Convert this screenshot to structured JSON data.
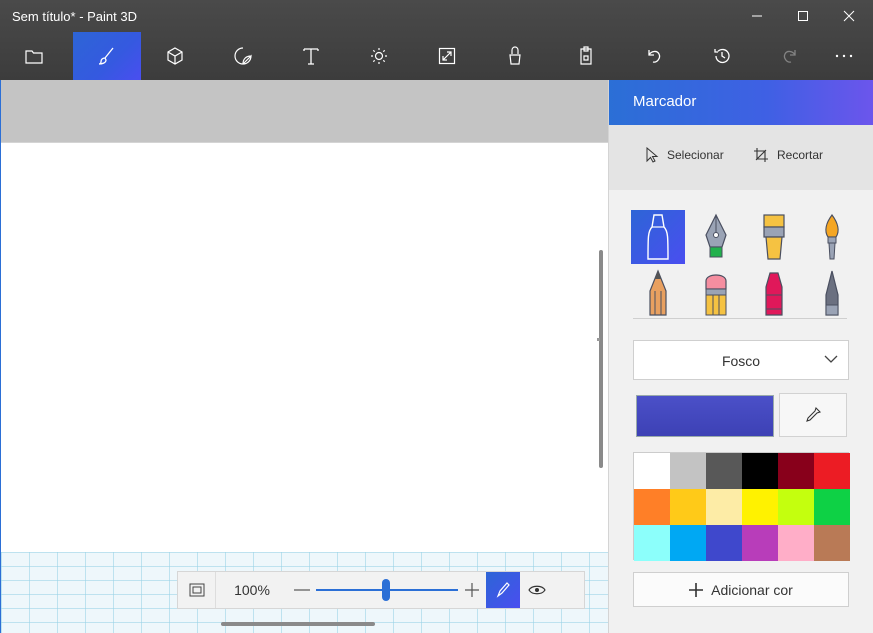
{
  "window": {
    "title": "Sem título* - Paint 3D"
  },
  "toolbar": {
    "items": [
      {
        "icon": "folder-icon"
      },
      {
        "icon": "brush-icon",
        "active": true
      },
      {
        "icon": "cube-icon"
      },
      {
        "icon": "sticker-icon"
      },
      {
        "icon": "text-icon",
        "glyph": "T"
      },
      {
        "icon": "effects-sun-icon"
      },
      {
        "icon": "canvas-resize-icon"
      },
      {
        "icon": "mixed-reality-icon"
      },
      {
        "icon": "paste-icon"
      },
      {
        "icon": "undo-icon"
      },
      {
        "icon": "history-icon"
      },
      {
        "icon": "redo-icon",
        "disabled": true
      },
      {
        "icon": "more-icon",
        "glyph": "···"
      }
    ]
  },
  "zoom": {
    "value": "100%",
    "minus": "—",
    "plus": "+",
    "slider_level_percent": 50
  },
  "panel": {
    "title": "Marcador",
    "select_label": "Selecionar",
    "crop_label": "Recortar",
    "brushes": [
      {
        "name": "marker",
        "active": true
      },
      {
        "name": "calligraphy-pen"
      },
      {
        "name": "oil-brush"
      },
      {
        "name": "watercolor"
      },
      {
        "name": "pencil"
      },
      {
        "name": "eraser"
      },
      {
        "name": "crayon"
      },
      {
        "name": "pixel-pen"
      }
    ],
    "finish": "Fosco",
    "current_color": "#4b50c8",
    "palette": [
      "#ffffff",
      "#c3c3c3",
      "#585858",
      "#000000",
      "#88001b",
      "#ec1c24",
      "#ff7f27",
      "#ffca18",
      "#fdeca6",
      "#fff200",
      "#c4ff0e",
      "#0ed145",
      "#8cfffb",
      "#00a8f3",
      "#3f48cc",
      "#b83dba",
      "#ffaec8",
      "#b97a56"
    ],
    "add_color_label": "Adicionar cor",
    "add_icon": "plus-icon"
  }
}
